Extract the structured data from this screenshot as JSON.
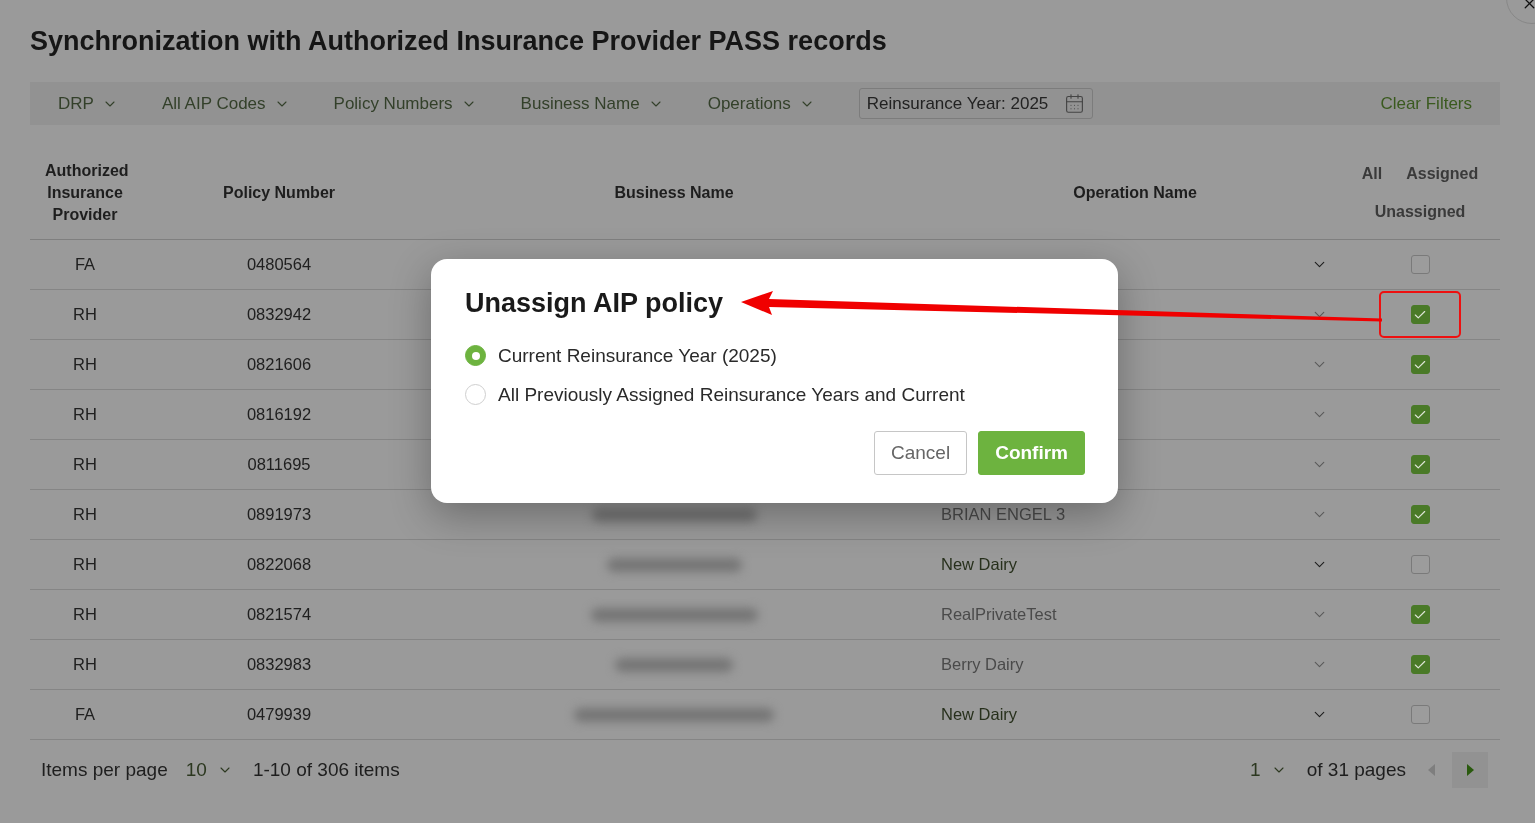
{
  "title": "Synchronization with Authorized Insurance Provider PASS records",
  "filters": [
    {
      "kind": "dropdown",
      "label": "DRP"
    },
    {
      "kind": "dropdown",
      "label": "All AIP Codes"
    },
    {
      "kind": "dropdown",
      "label": "Policy Numbers"
    },
    {
      "kind": "dropdown",
      "label": "Business Name"
    },
    {
      "kind": "dropdown",
      "label": "Operations"
    },
    {
      "kind": "date",
      "label": "Reinsurance Year: 2025"
    }
  ],
  "clear_filters": "Clear Filters",
  "table": {
    "columns": [
      "Authorized Insurance Provider",
      "Policy Number",
      "Business Name",
      "Operation Name"
    ],
    "assignment_filter": [
      "All",
      "Assigned",
      "Unassigned"
    ],
    "rows": [
      {
        "provider": "FA",
        "policy_number": "0480564",
        "business_name_blurred": false,
        "assigned": false,
        "highlighted": false
      },
      {
        "provider": "RH",
        "policy_number": "0832942",
        "business_name_blurred": false,
        "assigned": true,
        "highlighted": true
      },
      {
        "provider": "RH",
        "policy_number": "0821606",
        "business_name_blurred": false,
        "assigned": true,
        "highlighted": false
      },
      {
        "provider": "RH",
        "policy_number": "0816192",
        "business_name_blurred": false,
        "assigned": true,
        "highlighted": false
      },
      {
        "provider": "RH",
        "policy_number": "0811695",
        "business_name_blurred": false,
        "assigned": true,
        "highlighted": false
      },
      {
        "provider": "RH",
        "policy_number": "0891973",
        "business_name_blurred": true,
        "operation_name": "BRIAN ENGEL 3",
        "assigned": true,
        "highlighted": false
      },
      {
        "provider": "RH",
        "policy_number": "0822068",
        "business_name_blurred": true,
        "operation_name": "New Dairy",
        "assigned": false,
        "highlighted": false
      },
      {
        "provider": "RH",
        "policy_number": "0821574",
        "business_name_blurred": true,
        "operation_name": "RealPrivateTest",
        "assigned": true,
        "highlighted": false
      },
      {
        "provider": "RH",
        "policy_number": "0832983",
        "business_name_blurred": true,
        "operation_name": "Berry Dairy",
        "assigned": true,
        "highlighted": false
      },
      {
        "provider": "FA",
        "policy_number": "0479939",
        "business_name_blurred": true,
        "operation_name": "New Dairy",
        "assigned": false,
        "highlighted": false
      }
    ]
  },
  "pagination": {
    "items_per_page_label": "Items per page",
    "page_size": "10",
    "range": "1-10 of 306 items",
    "page": "1",
    "page_count": "of 31 pages",
    "prev_disabled": true,
    "next_disabled": false
  },
  "modal": {
    "title": "Unassign AIP policy",
    "options": [
      {
        "label": "Current Reinsurance Year (2025)",
        "selected": true
      },
      {
        "label": "All Previously Assigned Reinsurance Years and Current",
        "selected": false
      }
    ],
    "buttons": [
      {
        "kind": "secondary",
        "label": "Cancel"
      },
      {
        "kind": "primary",
        "label": "Confirm"
      }
    ]
  }
}
